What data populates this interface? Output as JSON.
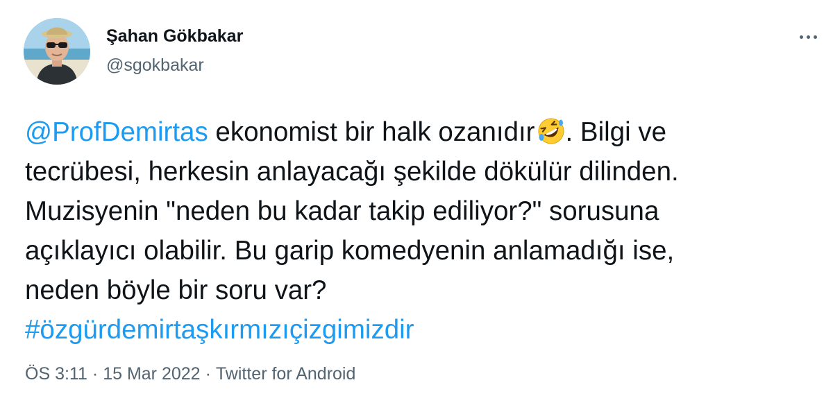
{
  "author": {
    "name": "Şahan Gökbakar",
    "handle": "@sgokbakar",
    "avatar_icon": "profile-photo"
  },
  "menu": {
    "icon": "more-dots-icon"
  },
  "tweet": {
    "lines": [
      {
        "mention": "@ProfDemirtas",
        "text": " ekonomist bir halk ozanıdır",
        "emoji": "rolling-on-floor-laughing-emoji",
        "after": ". Bilgi ve"
      },
      {
        "text": "tecrübesi, herkesin anlayacağı şekilde dökülür dilinden."
      },
      {
        "text": "Muzisyenin \"neden bu kadar takip ediliyor?\" sorusuna"
      },
      {
        "text": "açıklayıcı olabilir. Bu garip komedyenin anlamadığı ise,"
      },
      {
        "text": "neden böyle bir soru var?"
      },
      {
        "hashtag": "#özgürdemirtaşkırmızıçizgimizdir"
      }
    ]
  },
  "meta": {
    "time": "ÖS 3:11",
    "separator": "·",
    "date": "15 Mar 2022",
    "source": "Twitter for Android"
  },
  "colors": {
    "link": "#1d9bf0",
    "secondary_text": "#536471",
    "primary_text": "#0f1419"
  }
}
